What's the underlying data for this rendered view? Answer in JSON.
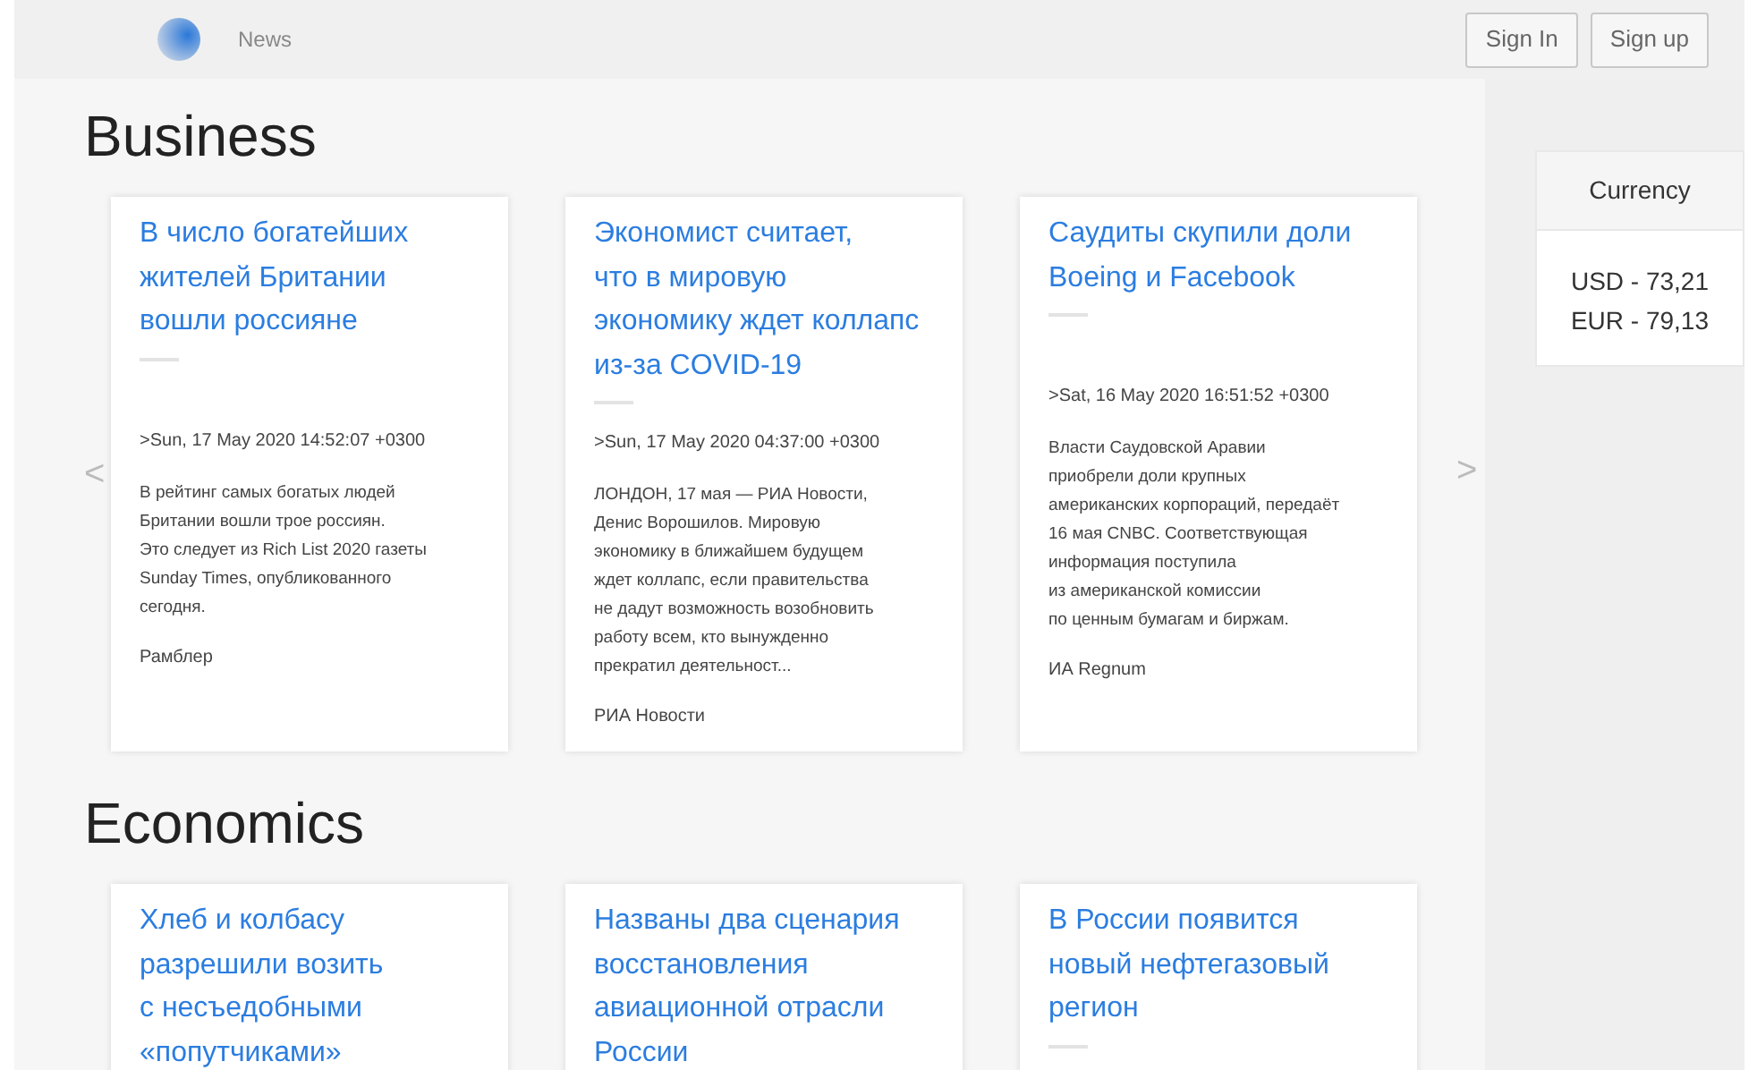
{
  "header": {
    "nav_link": "News",
    "buttons": [
      "Sign In",
      "Sign up"
    ]
  },
  "sections": [
    {
      "title": "Business",
      "prev": "<",
      "next": ">",
      "cards": [
        {
          "title": "В число богатейших\nжителей Британии\nвошли россияне",
          "date": ">Sun, 17 May 2020 14:52:07 +0300",
          "text": "В рейтинг самых богатых людей\nБритании вошли трое россиян.\nЭто следует из Rich List 2020 газеты\nSunday Times, опубликованного\nсегодня.",
          "source": "Рамблер"
        },
        {
          "title": "Экономист считает,\nчто в мировую\nэкономику ждет коллапс\nиз-за COVID-19",
          "date": ">Sun, 17 May 2020 04:37:00 +0300",
          "text": "ЛОНДОН, 17 мая — РИА Новости,\nДенис Ворошилов. Мировую\nэкономику в ближайшем будущем\nждет коллапс, если правительства\nне дадут возможность возобновить\nработу всем, кто вынужденно\nпрекратил деятельност...",
          "source": "РИА Новости"
        },
        {
          "title": "Саудиты скупили доли\nBoeing и Facebook",
          "date": ">Sat, 16 May 2020 16:51:52 +0300",
          "text": "Власти Саудовской Аравии\nприобрели доли крупных\nамериканских корпораций, передаёт\n16 мая CNBC. Соответствующая\nинформация поступила\nиз американской комиссии\nпо ценным бумагам и биржам.",
          "source": "ИА Regnum"
        }
      ]
    },
    {
      "title": "Economics",
      "cards": [
        {
          "title": "Хлеб и колбасу\nразрешили возить\nс несъедобными\n«попутчиками»"
        },
        {
          "title": "Названы два сценария\nвосстановления\nавиационной отрасли\nРоссии"
        },
        {
          "title": "В России появится\nновый нефтегазовый\nрегион"
        }
      ]
    }
  ],
  "currency": {
    "title": "Currency",
    "rates": [
      "USD - 73,21",
      "EUR - 79,13"
    ]
  }
}
